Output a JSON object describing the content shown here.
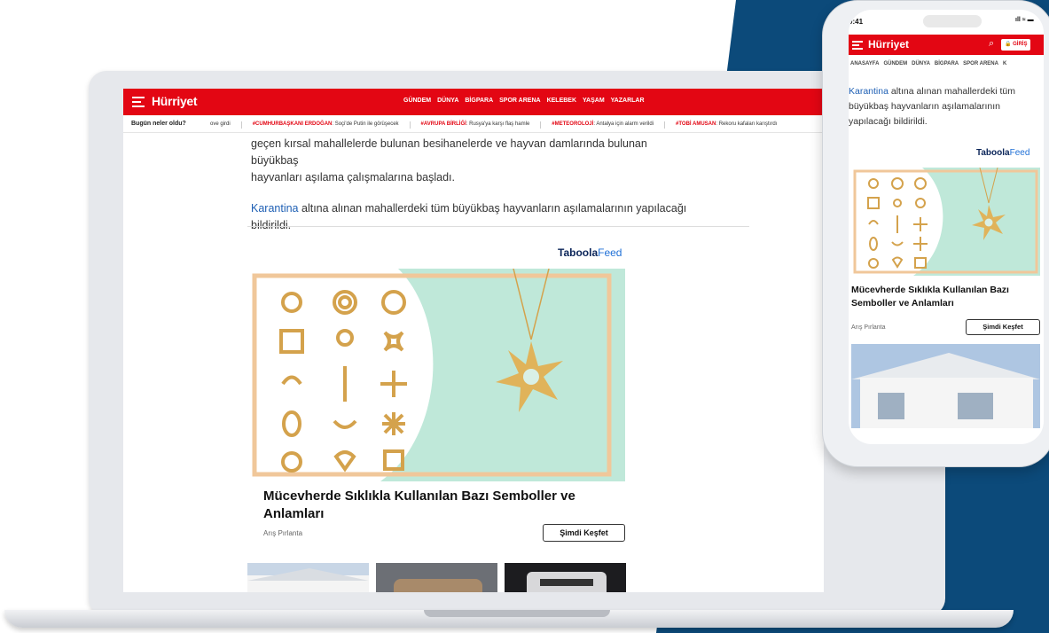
{
  "colors": {
    "brand_red": "#e30613",
    "navy": "#0c4a7a",
    "link_blue": "#1e5fb4",
    "gold": "#d4a24c",
    "mint": "#bfe8d9"
  },
  "desktop": {
    "logo": "Hürriyet",
    "nav": [
      "GÜNDEM",
      "DÜNYA",
      "BİGPARA",
      "SPOR ARENA",
      "KELEBEK",
      "YAŞAM",
      "YAZARLAR"
    ],
    "ticker_label": "Bugün neler oldu?",
    "ticker": [
      {
        "tag": "",
        "text": "ove girdi"
      },
      {
        "tag": "#CUMHURBAŞKANI ERDOĞAN",
        "text": ": Soçi'de Putin ile görüşecek"
      },
      {
        "tag": "#AVRUPA BİRLİĞİ",
        "text": ": Rusya'ya karşı flaş hamle"
      },
      {
        "tag": "#METEOROLOJİ",
        "text": ": Antalya için alarm verildi"
      },
      {
        "tag": "#TOBİ AMUSAN",
        "text": ": Rekoru kafaları karıştırdı"
      }
    ],
    "article_line1": "geçen kırsal mahallelerde bulunan besihanelerde ve hayvan damlarında bulunan büyükbaş",
    "article_line2": "hayvanları aşılama çalışmalarına başladı.",
    "article_link": "Karantina",
    "article_rest": " altına alınan mahallerdeki tüm büyükbaş hayvanların aşılamalarının yapılacağı bildirildi.",
    "taboola_main": "Taboola",
    "taboola_feed": "Feed",
    "ad_title": "Mücevherde Sıklıkla Kullanılan Bazı Semboller ve Anlamları",
    "ad_source": "Arış Pırlanta",
    "ad_cta": "Şimdi Keşfet"
  },
  "phone": {
    "time": "9:41",
    "status_icons": "ıll ≈ ▬",
    "logo": "Hürriyet",
    "login": "GİRİŞ",
    "nav": [
      "ANASAYFA",
      "GÜNDEM",
      "DÜNYA",
      "BİGPARA",
      "SPOR ARENA",
      "K"
    ],
    "article_link": "Karantina",
    "article_rest": " altına alınan mahallerdeki tüm büyükbaş hayvanların aşılamalarının yapılacağı bildirildi.",
    "taboola_main": "Taboola",
    "taboola_feed": "Feed",
    "ad_title": "Mücevherde Sıklıkla Kullanılan Bazı Semboller ve Anlamları",
    "ad_source": "Arış Pırlanta",
    "ad_cta": "Şimdi Keşfet"
  }
}
